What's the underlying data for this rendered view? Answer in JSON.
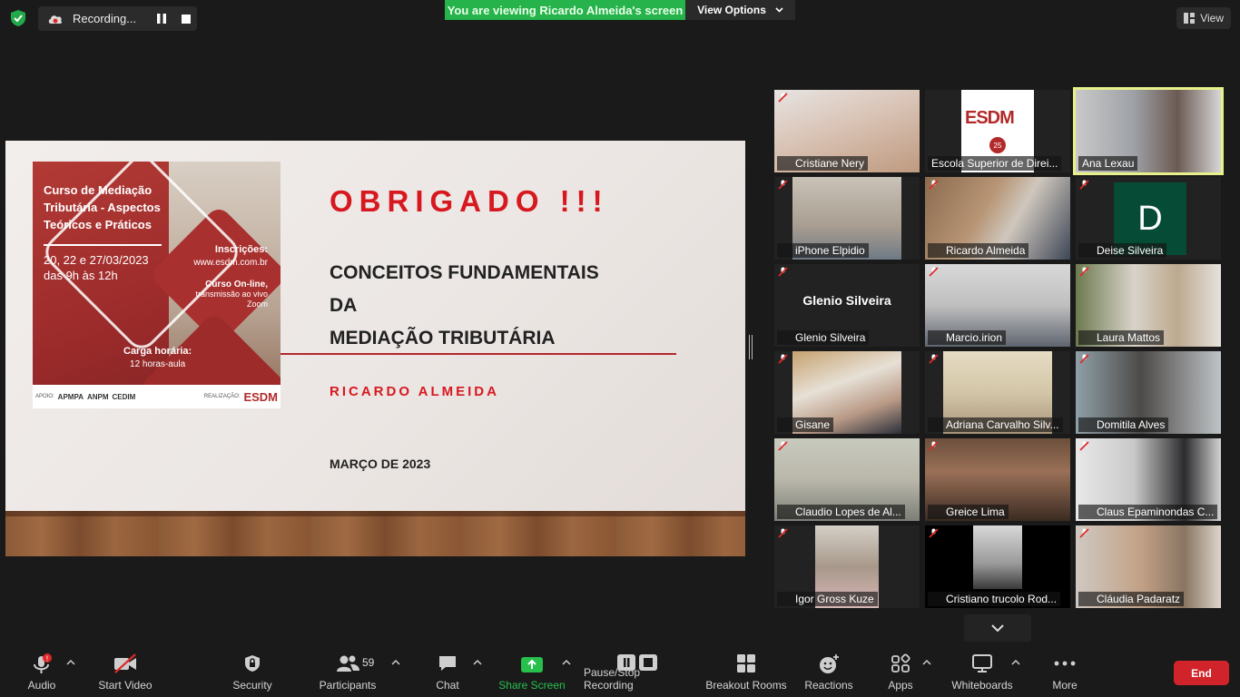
{
  "top": {
    "recording_label": "Recording...",
    "banner_text": "You are viewing Ricardo Almeida's screen",
    "view_options_label": "View Options",
    "view_label": "View"
  },
  "slide": {
    "poster": {
      "title": "Curso de Mediação Tributária - Aspectos Teóricos e Práticos",
      "dates": "20, 22 e 27/03/2023",
      "hours": "das 9h às 12h",
      "inscricoes_label": "Inscrições:",
      "inscricoes_url": "www.esdm.com.br",
      "online_label": "Curso On-line,",
      "online_detail": "transmissão ao vivo",
      "online_platform": "Zoom",
      "carga_label": "Carga horária:",
      "carga_value": "12 horas-aula",
      "apoio_label": "APOIO:",
      "sponsors": [
        "APMPA",
        "ANPM",
        "CEDIM"
      ],
      "realizacao_label": "REALIZAÇÃO:",
      "org_logo": "ESDM"
    },
    "heading": "OBRIGADO !!!",
    "line1": "CONCEITOS FUNDAMENTAIS",
    "line2": "DA",
    "line3": "MEDIAÇÃO TRIBUTÁRIA",
    "author": "RICARDO ALMEIDA",
    "date": "MARÇO DE 2023"
  },
  "gallery": {
    "tiles": [
      {
        "name": "Cristiane Nery"
      },
      {
        "name": "Escola Superior de Direi..."
      },
      {
        "name": "Ana Lexau"
      },
      {
        "name": "iPhone Elpidio"
      },
      {
        "name": "Ricardo Almeida"
      },
      {
        "name": "Deise Silveira",
        "letter": "D"
      },
      {
        "name": "Glenio Silveira",
        "display_name": "Glenio Silveira"
      },
      {
        "name": "Marcio.irion"
      },
      {
        "name": "Laura Mattos"
      },
      {
        "name": "Gisane"
      },
      {
        "name": "Adriana Carvalho Silv..."
      },
      {
        "name": "Domitila Alves"
      },
      {
        "name": "Claudio Lopes de Al..."
      },
      {
        "name": "Greice Lima"
      },
      {
        "name": "Claus Epaminondas C..."
      },
      {
        "name": "Igor Gross Kuze"
      },
      {
        "name": "Cristiano trucolo Rod..."
      },
      {
        "name": "Cláudia Padaratz"
      }
    ],
    "esdm_tile_logo": "ESDM",
    "esdm_tile_badge": "25"
  },
  "toolbar": {
    "audio": "Audio",
    "start_video": "Start Video",
    "security": "Security",
    "participants": "Participants",
    "participants_count": "59",
    "chat": "Chat",
    "share_screen": "Share Screen",
    "pause_stop": "Pause/Stop Recording",
    "breakout": "Breakout Rooms",
    "reactions": "Reactions",
    "apps": "Apps",
    "whiteboards": "Whiteboards",
    "more": "More",
    "end": "End"
  },
  "colors": {
    "banner_green": "#26b34b",
    "end_red": "#d0242a",
    "slide_accent_red": "#d7181f",
    "active_speaker": "#e8f08a"
  }
}
